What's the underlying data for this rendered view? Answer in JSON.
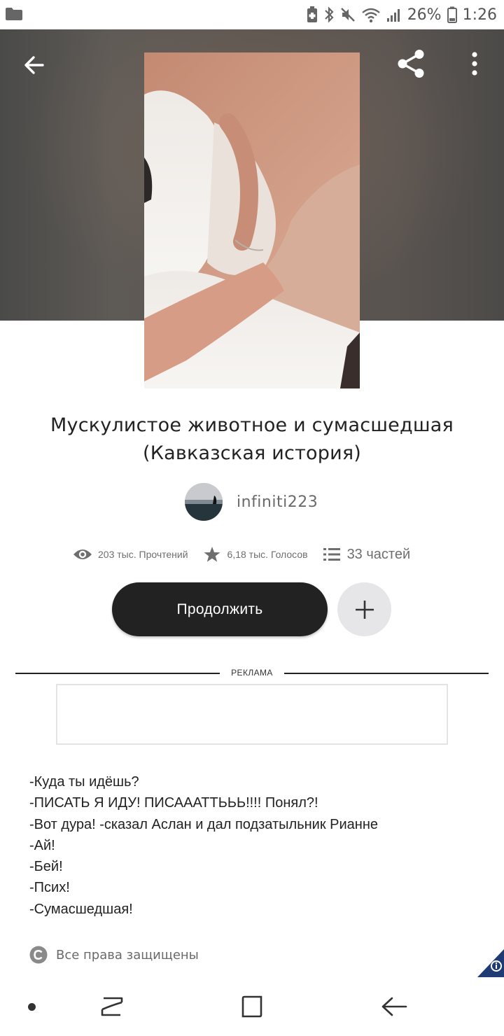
{
  "status_bar": {
    "battery": "26%",
    "time": "1:26",
    "icons": [
      "folder-icon",
      "battery-saver-icon",
      "bluetooth-icon",
      "mute-icon",
      "wifi-icon",
      "signal-icon",
      "battery-icon"
    ]
  },
  "header": {
    "back_icon": "arrow-left-icon",
    "share_icon": "share-icon",
    "more_icon": "more-vertical-icon"
  },
  "story": {
    "title_line1": "Мускулистое животное и сумасшедшая",
    "title_line2": "(Кавказская история)",
    "author": "infiniti223",
    "stats": {
      "reads": "203 тыс. Прочтений",
      "votes": "6,18 тыс. Голосов",
      "parts": "33 частей"
    },
    "continue_label": "Продолжить",
    "add_icon": "plus-icon"
  },
  "ad": {
    "label": "РЕКЛАМА"
  },
  "excerpt": [
    "-Куда ты идёшь?",
    "-ПИСАТЬ Я ИДУ! ПИСАААТТЬЬЬ!!!! Понял?!",
    "-Вот дура! -сказал Аслан и дал подзатыльник Рианне",
    "-Ай!",
    "-Бей!",
    "-Псих!",
    "-Сумасшедшая!"
  ],
  "copyright": {
    "icon": "copyright-icon",
    "text": "Все права защищены"
  },
  "nav_bar": {
    "icons": [
      "nav-dot-icon",
      "recent-apps-icon",
      "home-icon",
      "back-icon"
    ]
  },
  "colors": {
    "button_dark": "#222222",
    "button_light": "#e6e5e8",
    "help_badge": "#1f3b73",
    "text_muted": "#6e6e6e"
  }
}
